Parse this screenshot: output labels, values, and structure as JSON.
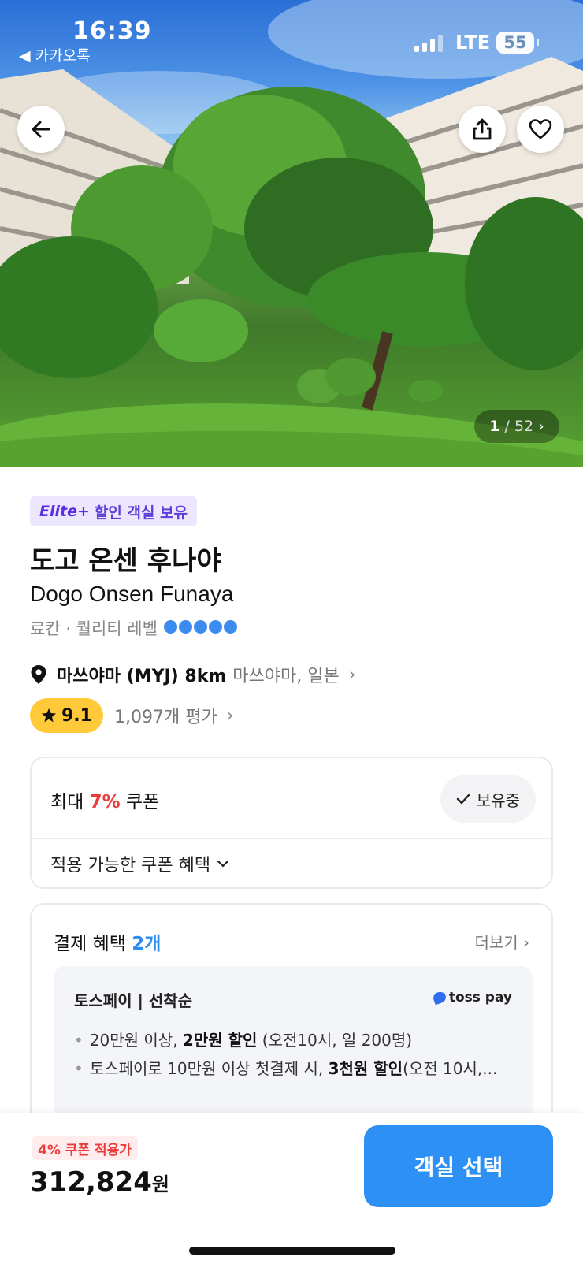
{
  "status_bar": {
    "time": "16:39",
    "back_app": "◀ 카카오톡",
    "network": "LTE",
    "battery": "55"
  },
  "hero": {
    "photo_counter_current": "1",
    "photo_counter_total": "/ 52",
    "icons": {
      "back": "arrow-left-icon",
      "share": "share-icon",
      "like": "heart-icon"
    }
  },
  "hotel": {
    "elite_brand": "Elite+",
    "elite_badge": "할인 객실 보유",
    "name_ko": "도고 온센 후나야",
    "name_en": "Dogo Onsen Funaya",
    "category": "료칸 · 퀄리티 레벨",
    "quality_level": 5,
    "location_main": "마쓰야마 (MYJ) 8km",
    "location_sub": "마쓰야마, 일본",
    "rating": "9.1",
    "review_count": "1,097개 평가"
  },
  "coupon": {
    "prefix": "최대 ",
    "percent": "7%",
    "suffix": " 쿠폰",
    "owned_label": "보유중",
    "benefits_label": "적용 가능한 쿠폰 혜택"
  },
  "payment": {
    "title": "결제 혜택 ",
    "count": "2개",
    "more_label": "더보기",
    "provider_title": "토스페이 | 선착순",
    "provider_logo": "toss pay",
    "items": [
      {
        "pre": "20만원 이상, ",
        "bold": "2만원 할인",
        "post": " (오전10시, 일 200명)"
      },
      {
        "pre": "토스페이로 10만원 이상 첫결제 시, ",
        "bold": "3천원 할인",
        "post": "(오전 10시,..."
      }
    ]
  },
  "bottom": {
    "coupon_tag": "4% 쿠폰 적용가",
    "price": "312,824",
    "currency": "원",
    "cta": "객실 선택"
  },
  "colors": {
    "accent_blue": "#2c90f4",
    "rating_yellow": "#ffc93a",
    "discount_red": "#f03b3b",
    "elite_purple": "#5c3fd8"
  }
}
